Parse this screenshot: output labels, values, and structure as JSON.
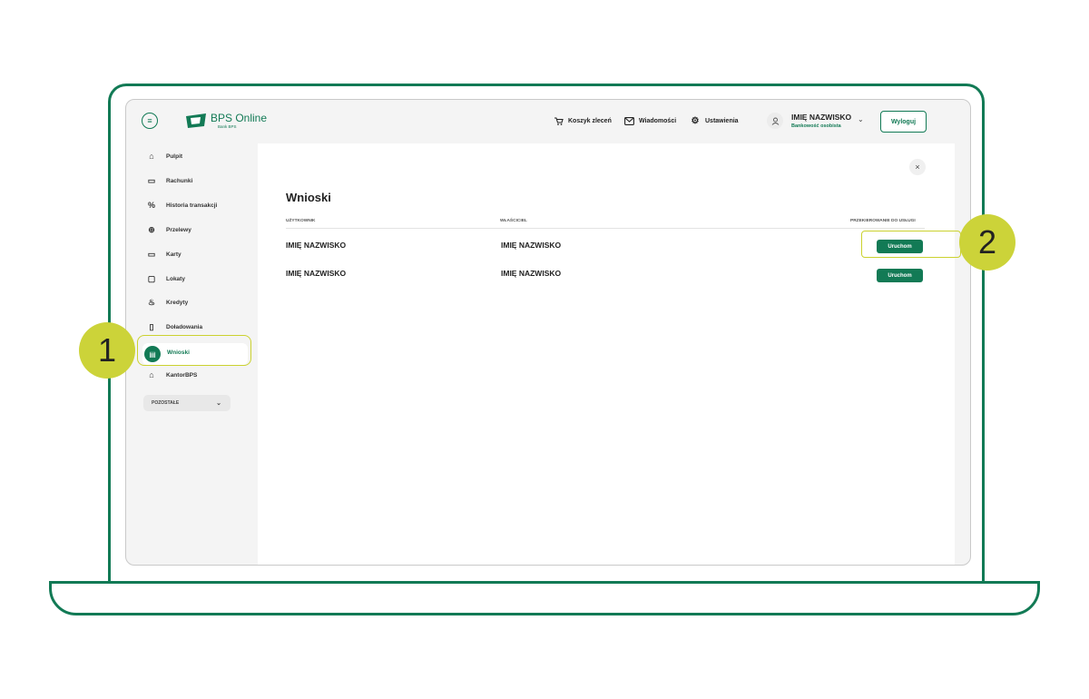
{
  "app": {
    "logo_title": "BPS Online",
    "logo_subtitle": "Bank BPS",
    "brand_color": "#127a55"
  },
  "header": {
    "nav": [
      {
        "label": "Koszyk zleceń",
        "icon": "cart-icon"
      },
      {
        "label": "Wiadomości",
        "icon": "mail-icon"
      },
      {
        "label": "Ustawienia",
        "icon": "gear-icon"
      }
    ],
    "user_name": "IMIĘ NAZWISKO",
    "user_type": "Bankowość osobista",
    "logout_label": "Wyloguj"
  },
  "sidebar": {
    "items": [
      {
        "label": "Pulpit",
        "icon": "home-icon"
      },
      {
        "label": "Rachunki",
        "icon": "wallet-icon"
      },
      {
        "label": "Historia transakcji",
        "icon": "history-icon"
      },
      {
        "label": "Przelewy",
        "icon": "transfer-icon"
      },
      {
        "label": "Karty",
        "icon": "card-icon"
      },
      {
        "label": "Lokaty",
        "icon": "deposit-icon"
      },
      {
        "label": "Kredyty",
        "icon": "loan-icon"
      },
      {
        "label": "Doładowania",
        "icon": "phone-icon"
      },
      {
        "label": "Wnioski",
        "icon": "document-icon",
        "active": true
      },
      {
        "label": "KantorBPS",
        "icon": "exchange-icon"
      }
    ],
    "others_label": "POZOSTAŁE"
  },
  "main": {
    "title": "Wnioski",
    "columns": [
      "UŻYTKOWNIK",
      "WŁAŚCICIEL",
      "PRZEKIEROWANIE DO USŁUGI"
    ],
    "rows": [
      {
        "user": "IMIĘ NAZWISKO",
        "owner": "IMIĘ NAZWISKO",
        "action": "Uruchom"
      },
      {
        "user": "IMIĘ NAZWISKO",
        "owner": "IMIĘ NAZWISKO",
        "action": "Uruchom"
      }
    ]
  },
  "annotations": {
    "badge1": "1",
    "badge2": "2",
    "highlight_color": "#cbd22f"
  }
}
